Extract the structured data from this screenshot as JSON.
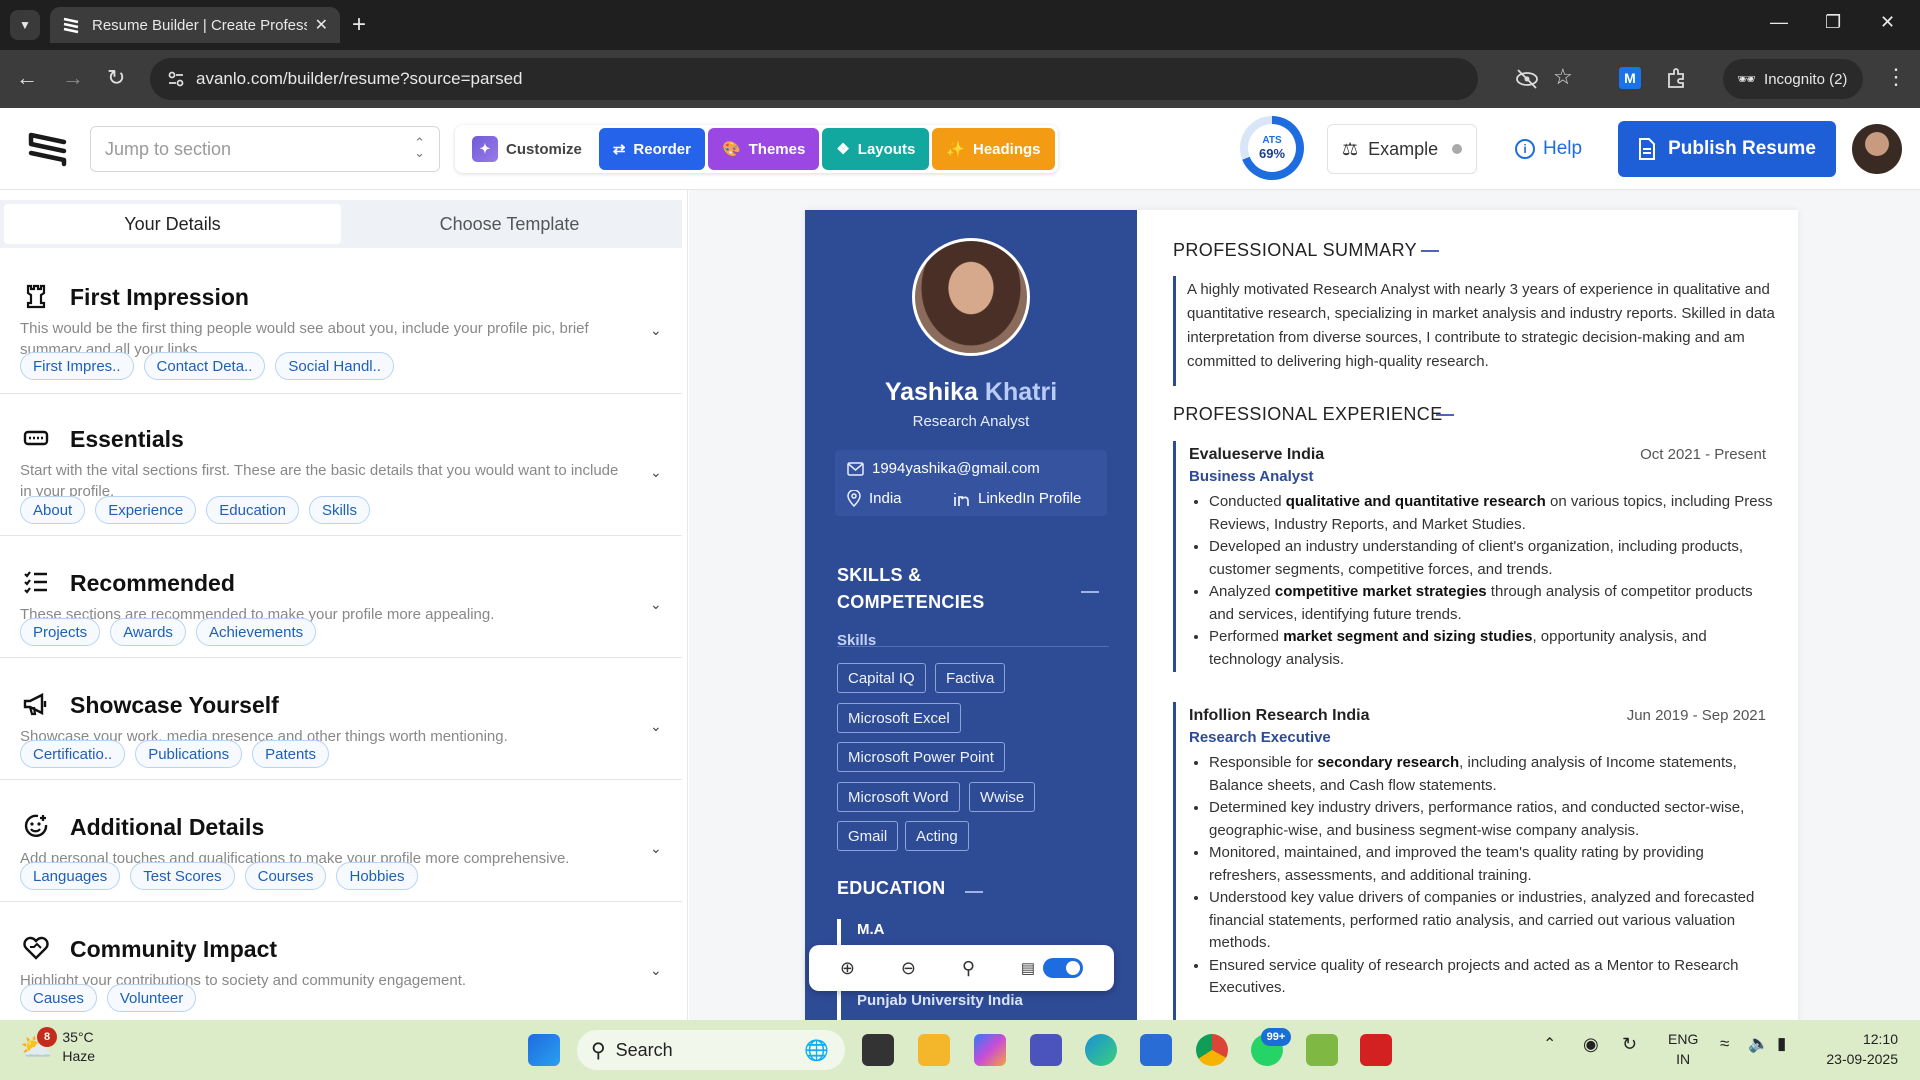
{
  "browser": {
    "tab_title": "Resume Builder | Create Profess",
    "url": "avanlo.com/builder/resume?source=parsed",
    "incognito_label": "Incognito (2)",
    "extension_letter": "M"
  },
  "header": {
    "jump_placeholder": "Jump to section",
    "tools": [
      {
        "label": "Customize",
        "color": "#ffffff"
      },
      {
        "label": "Reorder",
        "color": "#2563eb"
      },
      {
        "label": "Themes",
        "color": "#9b47e3"
      },
      {
        "label": "Layouts",
        "color": "#12a8a0"
      },
      {
        "label": "Headings",
        "color": "#f49b14"
      }
    ],
    "ats_label": "ATS",
    "ats_score": "69%",
    "ats_value": 0.69,
    "example_label": "Example",
    "help_label": "Help",
    "publish_label": "Publish Resume"
  },
  "left": {
    "tabs": [
      "Your Details",
      "Choose Template"
    ],
    "sections": [
      {
        "title": "First Impression",
        "desc": "This would be the first thing people would see about you, include your profile pic, brief summary and all your links.",
        "chips": [
          "First Impres..",
          "Contact Deta..",
          "Social Handl.."
        ]
      },
      {
        "title": "Essentials",
        "desc": "Start with the vital sections first. These are the basic details that you would want to include in your profile.",
        "chips": [
          "About",
          "Experience",
          "Education",
          "Skills"
        ]
      },
      {
        "title": "Recommended",
        "desc": "These sections are recommended to make your profile more appealing.",
        "chips": [
          "Projects",
          "Awards",
          "Achievements"
        ]
      },
      {
        "title": "Showcase Yourself",
        "desc": "Showcase your work, media presence and other things worth mentioning.",
        "chips": [
          "Certificatio..",
          "Publications",
          "Patents"
        ]
      },
      {
        "title": "Additional Details",
        "desc": "Add personal touches and qualifications to make your profile more comprehensive.",
        "chips": [
          "Languages",
          "Test Scores",
          "Courses",
          "Hobbies"
        ]
      },
      {
        "title": "Community Impact",
        "desc": "Highlight your contributions to society and community engagement.",
        "chips": [
          "Causes",
          "Volunteer"
        ]
      }
    ]
  },
  "resume": {
    "first_name": "Yashika",
    "last_name": "Khatri",
    "role": "Research Analyst",
    "email": "1994yashika@gmail.com",
    "location": "India",
    "linkedin": "LinkedIn Profile",
    "skills_heading_1": "SKILLS &",
    "skills_heading_2": "COMPETENCIES",
    "skills_sub": "Skills",
    "skills": [
      "Capital IQ",
      "Factiva",
      "Microsoft Excel",
      "Microsoft Power Point",
      "Microsoft Word",
      "Wwise",
      "Gmail",
      "Acting"
    ],
    "education_heading": "EDUCATION",
    "education": [
      {
        "degree": "M.A",
        "school": "Punjab University India"
      }
    ],
    "summary_heading": "PROFESSIONAL SUMMARY",
    "summary": "A highly motivated Research Analyst with nearly 3 years of experience in qualitative and quantitative research, specializing in market analysis and industry reports. Skilled in data interpretation from diverse sources, I contribute to strategic decision-making and am committed to delivering high-quality research.",
    "experience_heading": "PROFESSIONAL EXPERIENCE",
    "jobs": [
      {
        "company": "Evalueserve India",
        "dates": "Oct 2021 - Present",
        "title": "Business Analyst",
        "bullets": [
          [
            "Conducted ",
            "qualitative and quantitative research",
            " on various topics, including Press Reviews, Industry Reports, and Market Studies."
          ],
          [
            "Developed an industry understanding of client's organization, including products, customer segments, competitive forces, and trends.",
            "",
            ""
          ],
          [
            "Analyzed ",
            "competitive market strategies",
            " through analysis of competitor products and services, identifying future trends."
          ],
          [
            "Performed ",
            "market segment and sizing studies",
            ", opportunity analysis, and technology analysis."
          ]
        ]
      },
      {
        "company": "Infollion Research India",
        "dates": "Jun 2019 - Sep 2021",
        "title": "Research Executive",
        "bullets": [
          [
            "Responsible for ",
            "secondary research",
            ", including analysis of Income statements, Balance sheets, and Cash flow statements."
          ],
          [
            "Determined key industry drivers, performance ratios, and conducted sector-wise, geographic-wise, and business segment-wise company analysis.",
            "",
            ""
          ],
          [
            "Monitored, maintained, and improved the team's quality rating by providing refreshers, assessments, and additional training.",
            "",
            ""
          ],
          [
            "Understood key value drivers of companies or industries, analyzed and forecasted financial statements, performed ratio analysis, and carried out various valuation methods.",
            "",
            ""
          ],
          [
            "Ensured service quality of research projects and acted as a Mentor to Research Executives.",
            "",
            ""
          ]
        ]
      }
    ]
  },
  "taskbar": {
    "weather_badge": "8",
    "temperature": "35°C",
    "condition": "Haze",
    "search_label": "Search",
    "whatsapp_badge": "99+",
    "lang1": "ENG",
    "lang2": "IN",
    "time": "12:10",
    "date": "23-09-2025"
  }
}
